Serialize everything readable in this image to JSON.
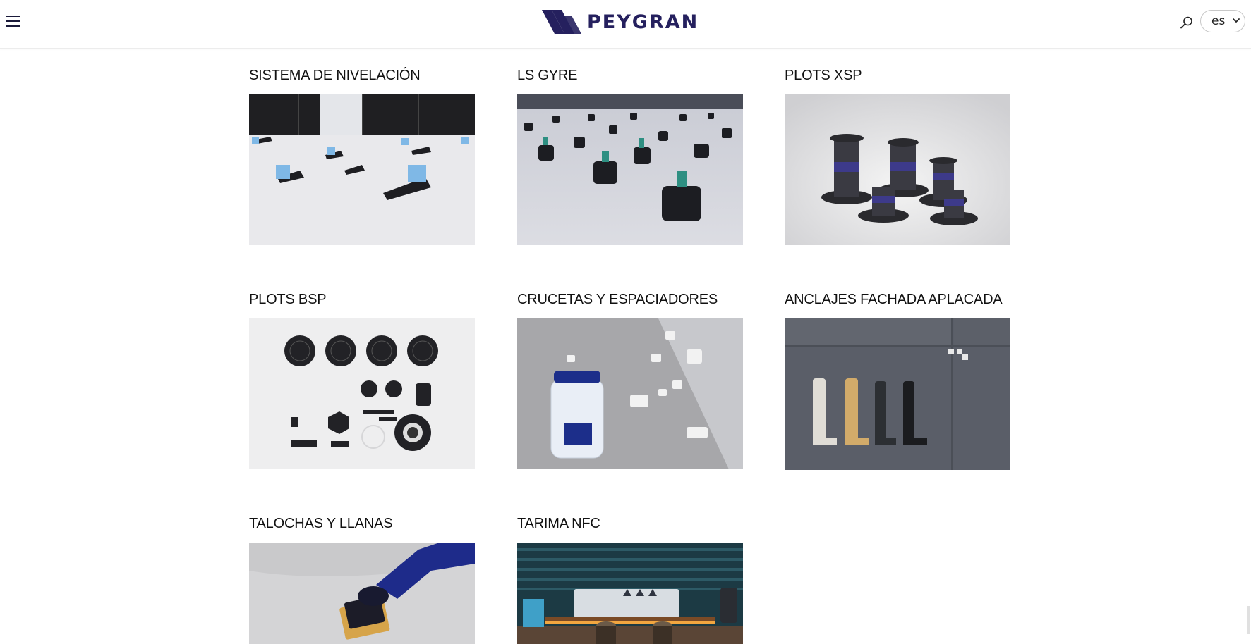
{
  "header": {
    "logo_text": "PEYGRAN",
    "language": {
      "selected": "es"
    }
  },
  "products": [
    {
      "title": "SISTEMA DE NIVELACIÓN"
    },
    {
      "title": "LS GYRE"
    },
    {
      "title": "PLOTS XSP"
    },
    {
      "title": "PLOTS BSP"
    },
    {
      "title": "CRUCETAS Y ESPACIADORES"
    },
    {
      "title": "ANCLAJES FACHADA APLACADA"
    },
    {
      "title": "TALOCHAS Y LLANAS"
    },
    {
      "title": "TARIMA NFC"
    }
  ],
  "colors": {
    "brand": "#25205e",
    "accent_blue": "#7fb8e6",
    "text": "#111111"
  },
  "icons": {
    "menu": "hamburger-icon",
    "search": "search-icon",
    "dropdown": "chevron-down-icon"
  }
}
